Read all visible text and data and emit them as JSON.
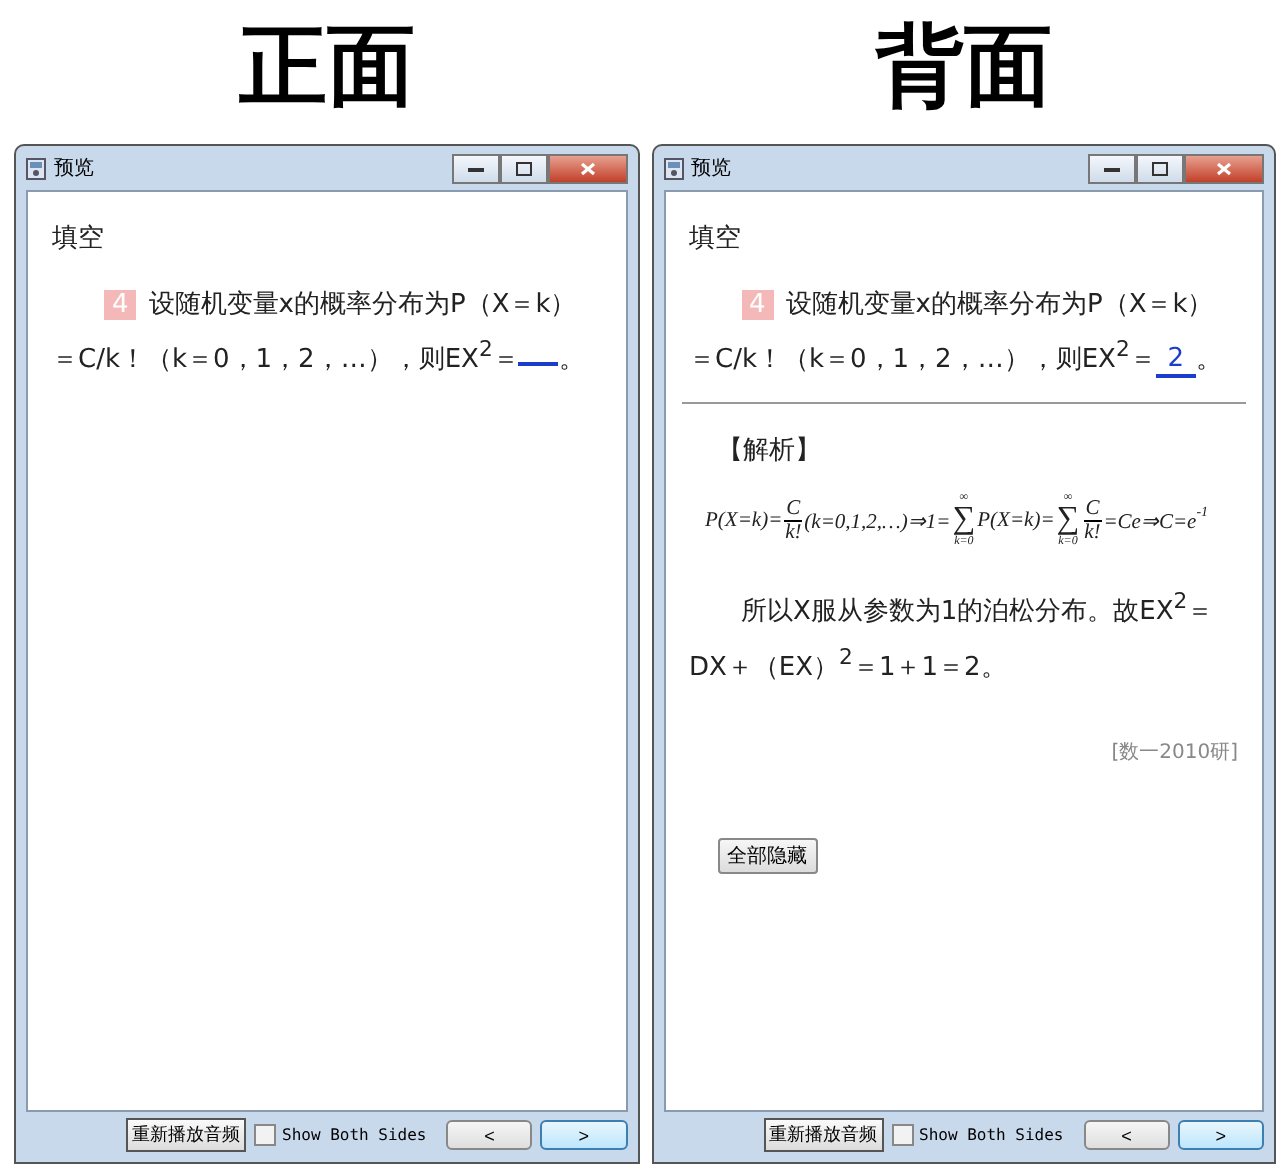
{
  "panels": [
    {
      "heading": "正面",
      "window": {
        "title": "预览"
      },
      "section": "填空",
      "question": {
        "number": "4",
        "text": "设随机变量x的概率分布为P（X＝k）＝C/k！（k＝0，1，2，…），则EX$^{2}$＝",
        "end": "。"
      },
      "footer": {
        "replay_button": "重新播放音频",
        "show_both": {
          "label": "Show Both Sides",
          "checked": false
        },
        "prev_button": "<",
        "next_button": ">"
      }
    },
    {
      "heading": "背面",
      "window": {
        "title": "预览"
      },
      "section": "填空",
      "question": {
        "number": "4",
        "text": "设随机变量x的概率分布为P（X＝k）＝C/k！（k＝0，1，2，…），则EX$^{2}$＝",
        "answer": "2",
        "end": "。"
      },
      "explanation": {
        "title": "【解析】",
        "formula": [
          {
            "kind": "text",
            "text": "P(X=k)="
          },
          {
            "kind": "frac",
            "num": "C",
            "den": "k!"
          },
          {
            "kind": "text",
            "text": "(k=0,1,2,…)⇒1="
          },
          {
            "kind": "sum",
            "symbol": "∑",
            "upper": "∞",
            "lower": "k=0"
          },
          {
            "kind": "text",
            "text": "P(X=k)="
          },
          {
            "kind": "sum",
            "symbol": "∑",
            "upper": "∞",
            "lower": "k=0"
          },
          {
            "kind": "frac",
            "num": "C",
            "den": "k!"
          },
          {
            "kind": "text",
            "text": "=Ce⇒C=e"
          },
          {
            "kind": "sup",
            "text": "-1"
          }
        ],
        "text": "所以X服从参数为1的泊松分布。故EX$^{2}$＝DX＋（EX）$^{2}$＝1＋1＝2。",
        "source": "[数一2010研]",
        "hide_button": "全部隐藏"
      },
      "footer": {
        "replay_button": "重新播放音频",
        "show_both": {
          "label": "Show Both Sides",
          "checked": false
        },
        "prev_button": "<",
        "next_button": ">"
      }
    }
  ]
}
